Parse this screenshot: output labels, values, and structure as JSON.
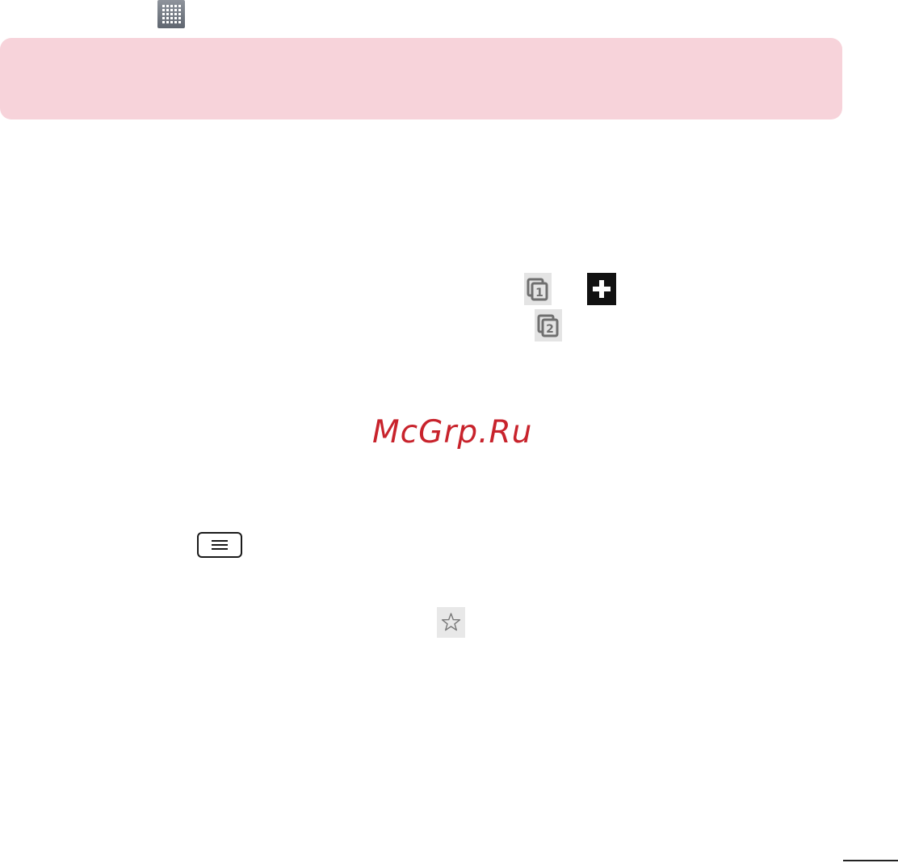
{
  "watermark": {
    "text": "McGrp.Ru",
    "color": "#c8232c"
  },
  "banner": {
    "color": "#f7d3da"
  },
  "icons": {
    "apps": "apps-grid-icon",
    "tabs_1": "tabs-1-icon",
    "new_tab": "plus-icon",
    "tabs_2": "tabs-2-icon",
    "menu": "menu-key-icon",
    "bookmark": "star-icon"
  },
  "tab_numbers": {
    "first": "1",
    "second": "2"
  }
}
